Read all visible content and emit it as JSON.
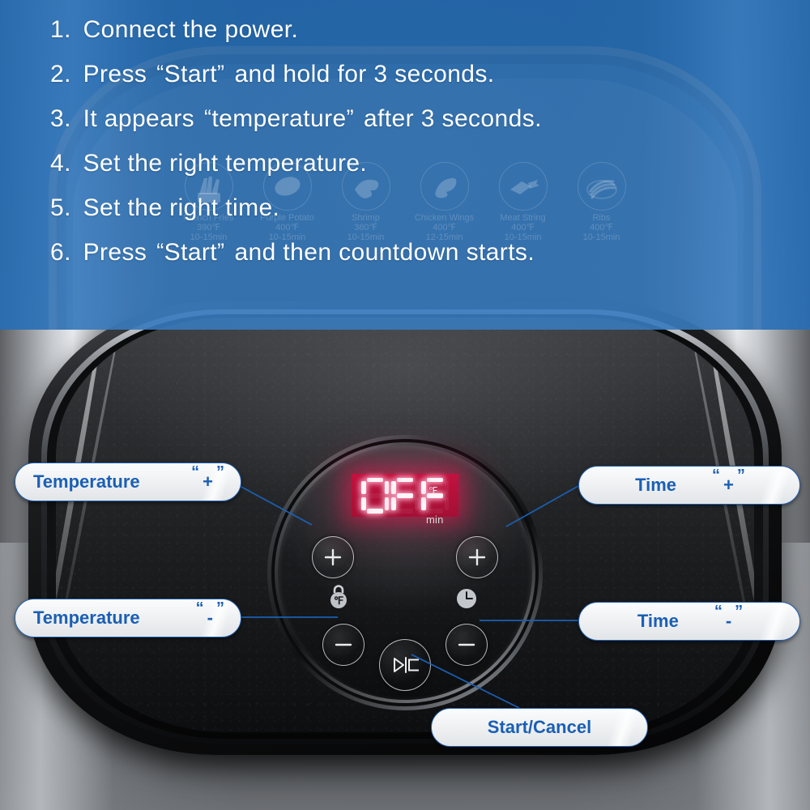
{
  "instructions": {
    "steps": [
      {
        "num": "1.",
        "text": "Connect the power."
      },
      {
        "num": "2.",
        "pre": "Press",
        "quoted": "Start",
        "post": "and hold for 3 seconds."
      },
      {
        "num": "3.",
        "pre": "It appears",
        "quoted": "temperature",
        "post": "after 3 seconds."
      },
      {
        "num": "4.",
        "text": "Set the right temperature."
      },
      {
        "num": "5.",
        "text": "Set the right time."
      },
      {
        "num": "6.",
        "pre": "Press",
        "quoted": "Start",
        "post": "and then countdown starts."
      }
    ],
    "open_quote": "“",
    "close_quote": "”"
  },
  "presets": [
    {
      "name": "French Fries",
      "temp": "390℉",
      "time": "10-15min",
      "icon": "french-fries-icon"
    },
    {
      "name": "Purple Potato",
      "temp": "400℉",
      "time": "10-15min",
      "icon": "potato-icon"
    },
    {
      "name": "Shrimp",
      "temp": "380℉",
      "time": "10-15min",
      "icon": "shrimp-icon"
    },
    {
      "name": "Chicken Wings",
      "temp": "400℉",
      "time": "12-15min",
      "icon": "chicken-wings-icon"
    },
    {
      "name": "Meat String",
      "temp": "400℉",
      "time": "10-15min",
      "icon": "meat-skewer-icon"
    },
    {
      "name": "Ribs",
      "temp": "400℉",
      "time": "10-15min",
      "icon": "ribs-icon"
    }
  ],
  "display": {
    "value": "OFF",
    "segments": [
      {
        "char": "O",
        "on": [
          "a",
          "b",
          "c",
          "d",
          "e",
          "f"
        ]
      },
      {
        "char": "F",
        "on": [
          "a",
          "e",
          "f",
          "g"
        ]
      },
      {
        "char": "F",
        "on": [
          "a",
          "e",
          "f",
          "g"
        ]
      }
    ],
    "unit_temperature": "℉",
    "unit_time": "min"
  },
  "callouts": {
    "temperature_plus": {
      "label": "Temperature",
      "symbol": "+"
    },
    "temperature_minus": {
      "label": "Temperature",
      "symbol": "-"
    },
    "time_plus": {
      "label": "Time",
      "symbol": "+"
    },
    "time_minus": {
      "label": "Time",
      "symbol": "-"
    },
    "start_cancel": {
      "label": "Start/Cancel"
    }
  },
  "panel_icons": {
    "lock_temp": "lock-fahrenheit-icon",
    "clock": "clock-icon",
    "start": "play-stop-icon"
  },
  "colors": {
    "overlay_blue": "#246cb4",
    "callout_border": "#1f5fae",
    "callout_text": "#1a5fb4",
    "led_red": "#e4164e",
    "led_core": "#fff4f8",
    "leader_line": "#1b60b4"
  }
}
